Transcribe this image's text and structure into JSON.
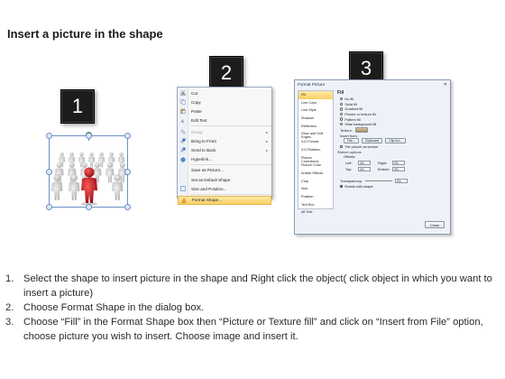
{
  "title": "Insert a picture in the shape",
  "badges": [
    "1",
    "2",
    "3"
  ],
  "context_menu": {
    "items": [
      {
        "label": "Cut",
        "icon": "scissors-icon",
        "dim": false
      },
      {
        "label": "Copy",
        "icon": "copy-icon",
        "dim": false
      },
      {
        "label": "Paste",
        "icon": "paste-icon",
        "dim": false
      },
      {
        "label": "Edit Text",
        "icon": "edit-text-icon",
        "dim": false
      },
      {
        "label": "Group",
        "icon": "group-icon",
        "dim": true,
        "arrow": "▸"
      },
      {
        "label": "Bring to Front",
        "icon": "bring-front-icon",
        "dim": false,
        "arrow": "▸"
      },
      {
        "label": "Send to Back",
        "icon": "send-back-icon",
        "dim": false,
        "arrow": "▸"
      },
      {
        "label": "Hyperlink...",
        "icon": "hyperlink-icon",
        "dim": false
      },
      {
        "label": "Save as Picture...",
        "icon": "",
        "dim": false
      },
      {
        "label": "Set as Default Shape",
        "icon": "",
        "dim": false
      },
      {
        "label": "Size and Position...",
        "icon": "size-position-icon",
        "dim": false
      },
      {
        "label": "Format Shape...",
        "icon": "format-shape-icon",
        "dim": false,
        "highlight": true
      }
    ]
  },
  "dialog": {
    "title": "Format Picture",
    "nav": [
      "Fill",
      "Line Color",
      "Line Style",
      "Shadow",
      "Reflection",
      "Glow and Soft Edges",
      "3-D Format",
      "3-D Rotation",
      "Picture Corrections",
      "Picture Color",
      "Artistic Effects",
      "Crop",
      "Size",
      "Position",
      "Text Box",
      "Alt Text"
    ],
    "pane_title": "Fill",
    "fill_options": [
      {
        "label": "No fill",
        "on": false
      },
      {
        "label": "Solid fill",
        "on": false
      },
      {
        "label": "Gradient fill",
        "on": false
      },
      {
        "label": "Picture or texture fill",
        "on": true
      },
      {
        "label": "Pattern fill",
        "on": false
      },
      {
        "label": "Slide background fill",
        "on": false
      }
    ],
    "texture_label": "Texture:",
    "insert_from_label": "Insert from:",
    "buttons": {
      "file": "File...",
      "clipboard": "Clipboard",
      "clip_art": "Clip Art..."
    },
    "tile_label": "Tile picture as texture",
    "stretch_label": "Stretch options",
    "offsets_label": "Offsets:",
    "offsets": [
      {
        "a_label": "Left:",
        "a_val": "0%",
        "b_label": "Right:",
        "b_val": "0%"
      },
      {
        "a_label": "Top:",
        "a_val": "0%",
        "b_label": "Bottom:",
        "b_val": "0%"
      }
    ],
    "transparency_label": "Transparency:",
    "transparency_value": "0%",
    "rotate_label": "Rotate with shape",
    "close_label": "Close"
  },
  "steps": [
    {
      "n": "1.",
      "text": "Select the shape to insert picture in the shape and Right click the object( click object in which you want to insert a picture)"
    },
    {
      "n": "2.",
      "text": "Choose Format Shape in the dialog box."
    },
    {
      "n": "3.",
      "text": "Choose “Fill” in the Format Shape box then “Picture or Texture fill”  and click on “Insert from File” option, choose picture you wish to insert. Choose image and insert it."
    }
  ],
  "colors": {
    "highlight": "#f8cf63",
    "selection_border": "#6a8fc8",
    "figure_red": "#c0141c",
    "figure_gray": "#d8d8d8"
  }
}
